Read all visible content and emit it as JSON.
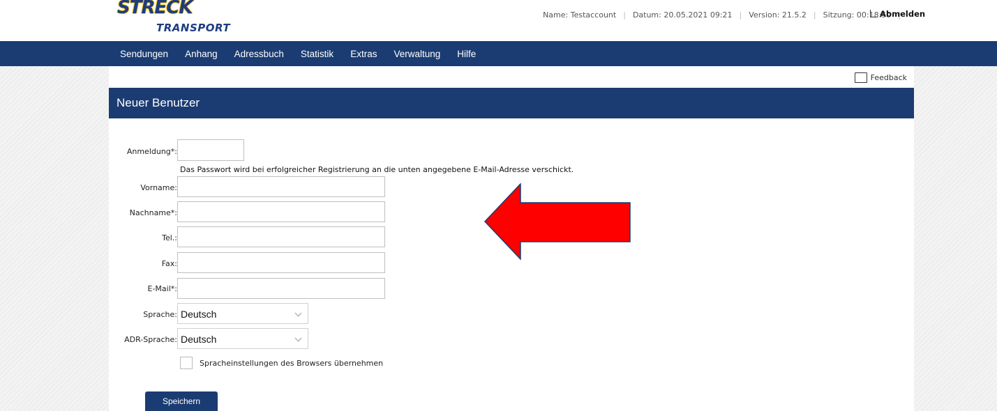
{
  "logo": {
    "line1": "STRECK",
    "line2": "TRANSPORT"
  },
  "status": {
    "name": "Name: Testaccount",
    "date": "Datum: 20.05.2021 09:21",
    "version": "Version: 21.5.2",
    "session": "Sitzung: 00:18:50",
    "logout": "Abmelden"
  },
  "nav": [
    "Sendungen",
    "Anhang",
    "Adressbuch",
    "Statistik",
    "Extras",
    "Verwaltung",
    "Hilfe"
  ],
  "feedback": "Feedback",
  "page_title": "Neuer Benutzer",
  "form": {
    "login_label": "Anmeldung*:",
    "password_hint": "Das Passwort wird bei erfolgreicher Registrierung an die unten angegebene E-Mail-Adresse verschickt.",
    "firstname_label": "Vorname:",
    "lastname_label": "Nachname*:",
    "phone_label": "Tel.:",
    "fax_label": "Fax:",
    "email_label": "E-Mail*:",
    "language_label": "Sprache:",
    "language_value": "Deutsch",
    "adr_language_label": "ADR-Sprache:",
    "adr_language_value": "Deutsch",
    "browser_lang_label": "Spracheinstellungen des Browsers übernehmen",
    "save_label": "Speichern"
  },
  "colors": {
    "nav_bg": "#1b3c72",
    "annotation_arrow": "#ff0000"
  },
  "icons": {
    "feedback": "speech-bubble-icon",
    "logout": "logout-icon",
    "dropdown": "chevron-down-icon",
    "annotation": "left-arrow-icon"
  }
}
